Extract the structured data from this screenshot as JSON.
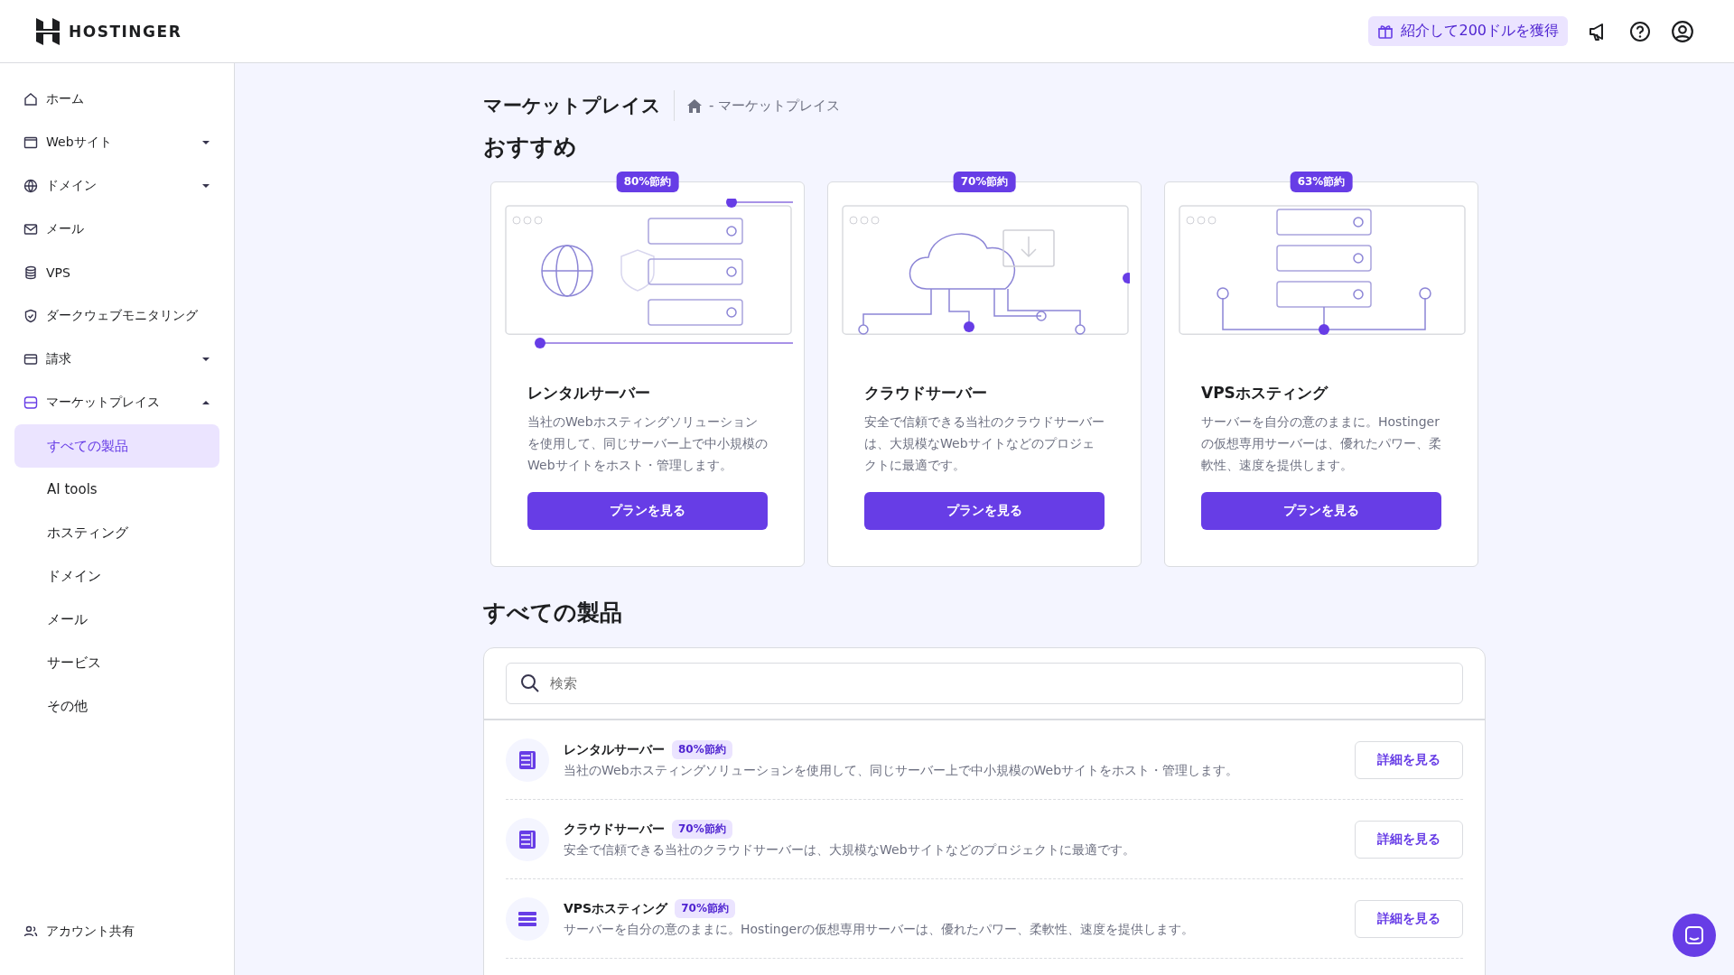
{
  "header": {
    "brand": "HOSTINGER",
    "referral": "紹介して200ドルを獲得"
  },
  "sidebar": {
    "items": [
      {
        "label": "ホーム"
      },
      {
        "label": "Webサイト",
        "expanded": false
      },
      {
        "label": "ドメイン",
        "expanded": false
      },
      {
        "label": "メール"
      },
      {
        "label": "VPS"
      },
      {
        "label": "ダークウェブモニタリング"
      },
      {
        "label": "請求",
        "expanded": false
      },
      {
        "label": "マーケットプレイス",
        "expanded": true,
        "children": [
          {
            "label": "すべての製品",
            "selected": true
          },
          {
            "label": "AI tools",
            "selected": false
          },
          {
            "label": "ホスティング",
            "selected": false
          },
          {
            "label": "ドメイン",
            "selected": false
          },
          {
            "label": "メール",
            "selected": false
          },
          {
            "label": "サービス",
            "selected": false
          },
          {
            "label": "その他",
            "selected": false
          }
        ]
      }
    ],
    "footer": "アカウント共有"
  },
  "page": {
    "title": "マーケットプレイス",
    "breadcrumb": "- マーケットプレイス"
  },
  "featured": {
    "heading": "おすすめ",
    "cards": [
      {
        "badge": "80%節約",
        "title": "レンタルサーバー",
        "description": "当社のWebホスティングソリューションを使用して、同じサーバー上で中小規模のWebサイトをホスト・管理します。",
        "button": "プランを見る"
      },
      {
        "badge": "70%節約",
        "title": "クラウドサーバー",
        "description": "安全で信頼できる当社のクラウドサーバーは、大規模なWebサイトなどのプロジェクトに最適です。",
        "button": "プランを見る"
      },
      {
        "badge": "63%節約",
        "title": "VPSホスティング",
        "description": "サーバーを自分の意のままに。Hostingerの仮想専用サーバーは、優れたパワー、柔軟性、速度を提供します。",
        "button": "プランを見る"
      }
    ]
  },
  "products": {
    "heading": "すべての製品",
    "search": {
      "placeholder": "検索"
    },
    "rows": [
      {
        "title": "レンタルサーバー",
        "badge": "80%節約",
        "description": "当社のWebホスティングソリューションを使用して、同じサーバー上で中小規模のWebサイトをホスト・管理します。",
        "button": "詳細を見る"
      },
      {
        "title": "クラウドサーバー",
        "badge": "70%節約",
        "description": "安全で信頼できる当社のクラウドサーバーは、大規模なWebサイトなどのプロジェクトに最適です。",
        "button": "詳細を見る"
      },
      {
        "title": "VPSホスティング",
        "badge": "70%節約",
        "description": "サーバーを自分の意のままに。Hostingerの仮想専用サーバーは、優れたパワー、柔軟性、速度を提供します。",
        "button": "詳細を見る"
      }
    ]
  }
}
